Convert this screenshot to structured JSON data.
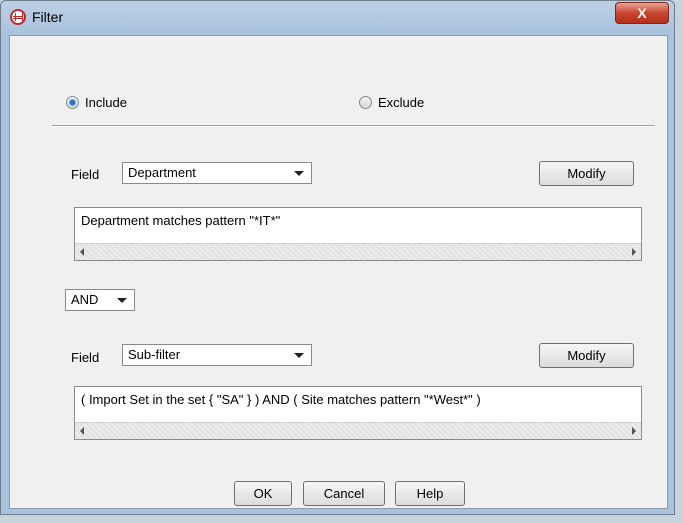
{
  "window": {
    "title": "Filter",
    "close_glyph": "X"
  },
  "mode": {
    "include_label": "Include",
    "exclude_label": "Exclude",
    "selected": "Include"
  },
  "filter1": {
    "field_label": "Field",
    "field_value": "Department",
    "modify_label": "Modify",
    "expression": "Department matches pattern \"*IT*\""
  },
  "operator": {
    "value": "AND"
  },
  "filter2": {
    "field_label": "Field",
    "field_value": "Sub-filter",
    "modify_label": "Modify",
    "expression": "( Import Set in the set { \"SA\" } ) AND ( Site matches pattern \"*West*\" )"
  },
  "buttons": {
    "ok": "OK",
    "cancel": "Cancel",
    "help": "Help"
  },
  "icons": {
    "window_icon": "filter-globe-icon",
    "close_icon": "close-icon",
    "dropdown_icon": "chevron-down-icon",
    "scroll_left_icon": "arrow-left-icon",
    "scroll_right_icon": "arrow-right-icon"
  },
  "colors": {
    "selection_accent": "#2a6fc9",
    "close_red": "#c9452f"
  }
}
